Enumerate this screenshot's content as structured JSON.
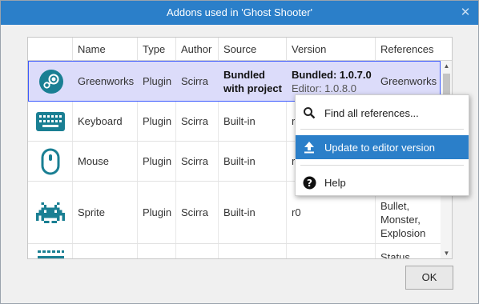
{
  "dialog": {
    "title": "Addons used in 'Ghost Shooter'",
    "close_glyph": "✕",
    "ok_label": "OK"
  },
  "table": {
    "columns": [
      "Name",
      "Type",
      "Author",
      "Source",
      "Version",
      "References"
    ],
    "rows": [
      {
        "icon": "steam-icon",
        "name": "Greenworks",
        "type": "Plugin",
        "author": "Scirra",
        "source_line1": "Bundled",
        "source_line2": "with project",
        "version_line1": "Bundled: 1.0.7.0",
        "version_line2": "Editor: 1.0.8.0",
        "references": "Greenworks",
        "selected": true
      },
      {
        "icon": "keyboard-icon",
        "name": "Keyboard",
        "type": "Plugin",
        "author": "Scirra",
        "source": "Built-in",
        "version": "r0",
        "references": ""
      },
      {
        "icon": "mouse-icon",
        "name": "Mouse",
        "type": "Plugin",
        "author": "Scirra",
        "source": "Built-in",
        "version": "r0",
        "references": ""
      },
      {
        "icon": "space-invader-icon",
        "name": "Sprite",
        "type": "Plugin",
        "author": "Scirra",
        "source": "Built-in",
        "version": "r0",
        "references_lines": [
          "Bullet,",
          "Monster,",
          "Explosion"
        ]
      },
      {
        "icon": "text-icon",
        "name": "",
        "type": "",
        "author": "",
        "source": "",
        "version": "",
        "references": "Status"
      }
    ]
  },
  "context_menu": {
    "items": [
      {
        "label": "Find all references...",
        "icon": "search-icon"
      },
      {
        "label": "Update to editor version",
        "icon": "upload-icon",
        "highlighted": true
      },
      {
        "label": "Help",
        "icon": "help-icon"
      }
    ]
  },
  "colors": {
    "title_bar": "#2b7fc9",
    "selection": "#dcdcfa",
    "selection_border": "#3d5afe",
    "icon_teal": "#1a7f93",
    "menu_highlight": "#2b7fc9"
  }
}
